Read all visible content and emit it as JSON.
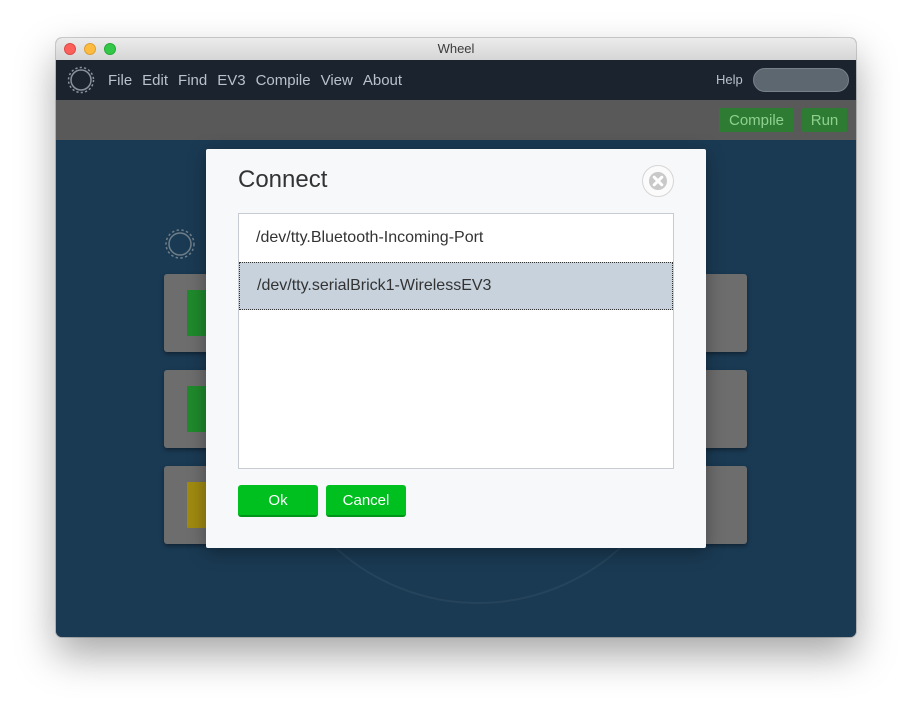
{
  "window": {
    "title": "Wheel"
  },
  "menubar": {
    "items": [
      {
        "label": "File"
      },
      {
        "label": "Edit"
      },
      {
        "label": "Find"
      },
      {
        "label": "EV3"
      },
      {
        "label": "Compile"
      },
      {
        "label": "View"
      },
      {
        "label": "About"
      }
    ],
    "help_label": "Help",
    "logo_icon": "gear-logo-icon"
  },
  "toolbar": {
    "compile_label": "Compile",
    "run_label": "Run"
  },
  "dialog": {
    "title": "Connect",
    "close_icon": "close-icon",
    "ports": [
      {
        "label": "/dev/tty.Bluetooth-Incoming-Port",
        "selected": false
      },
      {
        "label": "/dev/tty.serialBrick1-WirelessEV3",
        "selected": true
      }
    ],
    "ok_label": "Ok",
    "cancel_label": "Cancel"
  },
  "colors": {
    "accent_green": "#00c020",
    "menubar_bg": "#1a232e",
    "selection_bg": "#c7d2dd"
  }
}
